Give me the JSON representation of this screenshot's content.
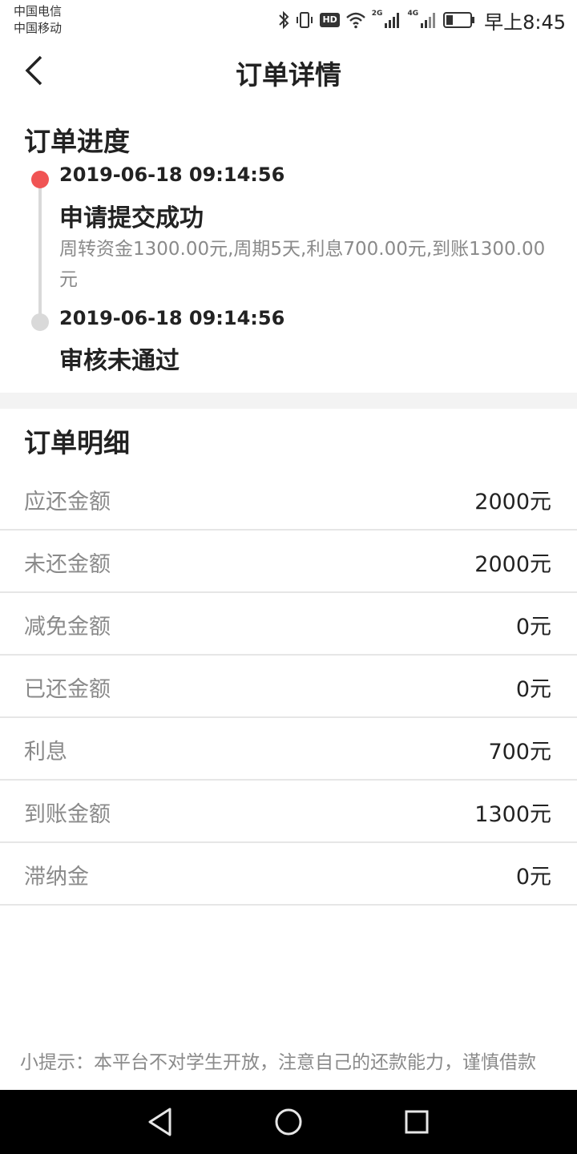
{
  "status_bar": {
    "carrier_1": "中国电信",
    "carrier_2": "中国移动",
    "hd": "HD",
    "net_1": "2G",
    "net_2": "4G",
    "time": "早上8:45"
  },
  "nav": {
    "title": "订单详情"
  },
  "progress": {
    "title": "订单进度",
    "items": [
      {
        "time": "2019-06-18 09:14:56",
        "status": "申请提交成功",
        "description": "周转资金1300.00元,周期5天,利息700.00元,到账1300.00元",
        "dot_color": "#f05454"
      },
      {
        "time": "2019-06-18 09:14:56",
        "status": "审核未通过",
        "dot_color": "#d9d9d9"
      }
    ]
  },
  "details": {
    "title": "订单明细",
    "rows": [
      {
        "label": "应还金额",
        "value": "2000元"
      },
      {
        "label": "未还金额",
        "value": "2000元"
      },
      {
        "label": "减免金额",
        "value": "0元"
      },
      {
        "label": "已还金额",
        "value": "0元"
      },
      {
        "label": "利息",
        "value": "700元"
      },
      {
        "label": "到账金额",
        "value": "1300元"
      },
      {
        "label": "滞纳金",
        "value": "0元"
      }
    ]
  },
  "tip": "小提示：本平台不对学生开放，注意自己的还款能力，谨慎借款",
  "system_nav": {
    "icons": [
      "back-triangle-icon",
      "home-circle-icon",
      "recent-square-icon"
    ]
  }
}
